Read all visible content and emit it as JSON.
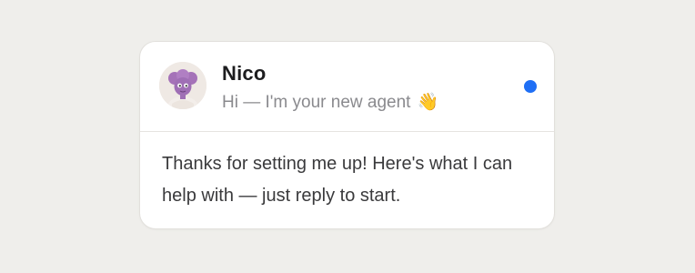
{
  "notification": {
    "sender_name": "Nico",
    "preview_text": "Hi — I'm your new agent",
    "preview_emoji": "👋",
    "avatar_icon": "purple-character-avatar",
    "unread": true,
    "unread_color": "#1f6ff5",
    "body_text": "Thanks for setting me up! Here's what I can help with — just reply to start."
  }
}
